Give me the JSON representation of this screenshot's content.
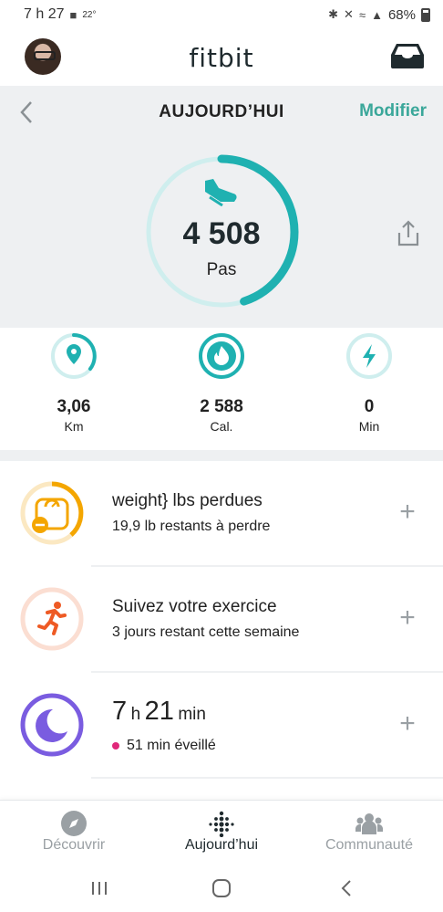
{
  "status_bar": {
    "time": "7 h 27",
    "temp": "22°",
    "battery": "68%"
  },
  "header": {
    "brand": "fitbit"
  },
  "subheader": {
    "title": "AUJOURD’HUI",
    "action": "Modifier"
  },
  "steps": {
    "value": "4 508",
    "unit": "Pas",
    "progress": 0.45
  },
  "colors": {
    "accent": "#1fb1b1",
    "ring_bg": "#cfeeee",
    "weight": "#f4a600",
    "exercise": "#ee5a24",
    "sleep": "#7a5ce0"
  },
  "stats": [
    {
      "value": "3,06",
      "unit": "Km",
      "icon": "location-pin-icon"
    },
    {
      "value": "2 588",
      "unit": "Cal.",
      "icon": "flame-icon"
    },
    {
      "value": "0",
      "unit": "Min",
      "icon": "lightning-icon"
    }
  ],
  "cards": {
    "weight": {
      "title": "weight} lbs perdues",
      "subtitle": "19,9 lb restants à perdre",
      "icon": "scale-icon"
    },
    "exercise": {
      "title": "Suivez votre exercice",
      "subtitle": "3 jours restant cette semaine",
      "icon": "runner-icon"
    },
    "sleep": {
      "hours": "7",
      "h": "h",
      "minutes": "21",
      "min": "min",
      "subtitle": "51 min éveillé",
      "icon": "moon-icon"
    }
  },
  "tabs": [
    {
      "label": "Découvrir",
      "icon": "compass-icon"
    },
    {
      "label": "Aujourd’hui",
      "icon": "fitbit-dots-icon"
    },
    {
      "label": "Communauté",
      "icon": "community-icon"
    }
  ]
}
